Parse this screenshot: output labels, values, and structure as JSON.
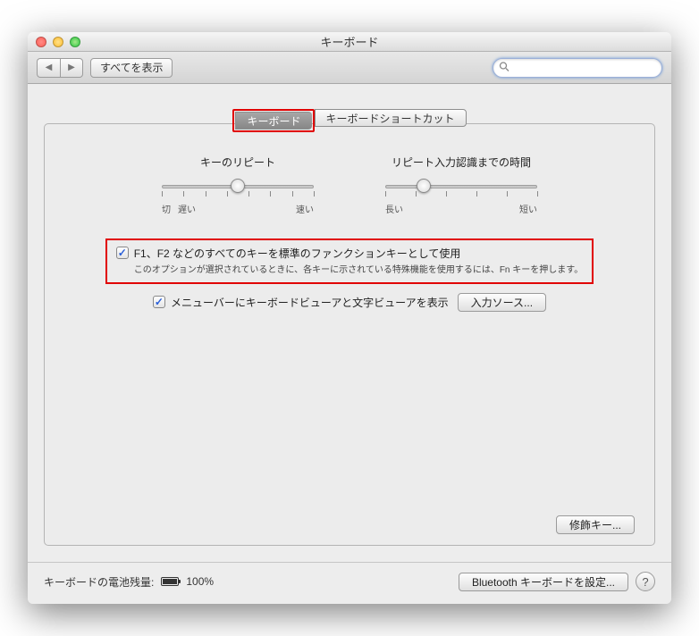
{
  "window": {
    "title": "キーボード"
  },
  "toolbar": {
    "show_all_label": "すべてを表示",
    "search_placeholder": ""
  },
  "tabs": {
    "keyboard": "キーボード",
    "shortcuts": "キーボードショートカット"
  },
  "sliders": {
    "repeat": {
      "label": "キーのリピート",
      "left": "切",
      "left2": "遅い",
      "right": "速い"
    },
    "delay": {
      "label": "リピート入力認識までの時間",
      "left": "長い",
      "right": "短い"
    }
  },
  "options": {
    "fn_keys": {
      "label": "F1、F2 などのすべてのキーを標準のファンクションキーとして使用",
      "desc": "このオプションが選択されているときに、各キーに示されている特殊機能を使用するには、Fn キーを押します。"
    },
    "viewer": {
      "label": "メニューバーにキーボードビューアと文字ビューアを表示"
    }
  },
  "buttons": {
    "input_sources": "入力ソース...",
    "modifier_keys": "修飾キー...",
    "bluetooth_setup": "Bluetooth キーボードを設定..."
  },
  "footer": {
    "battery_label": "キーボードの電池残量:",
    "battery_value": "100%"
  }
}
